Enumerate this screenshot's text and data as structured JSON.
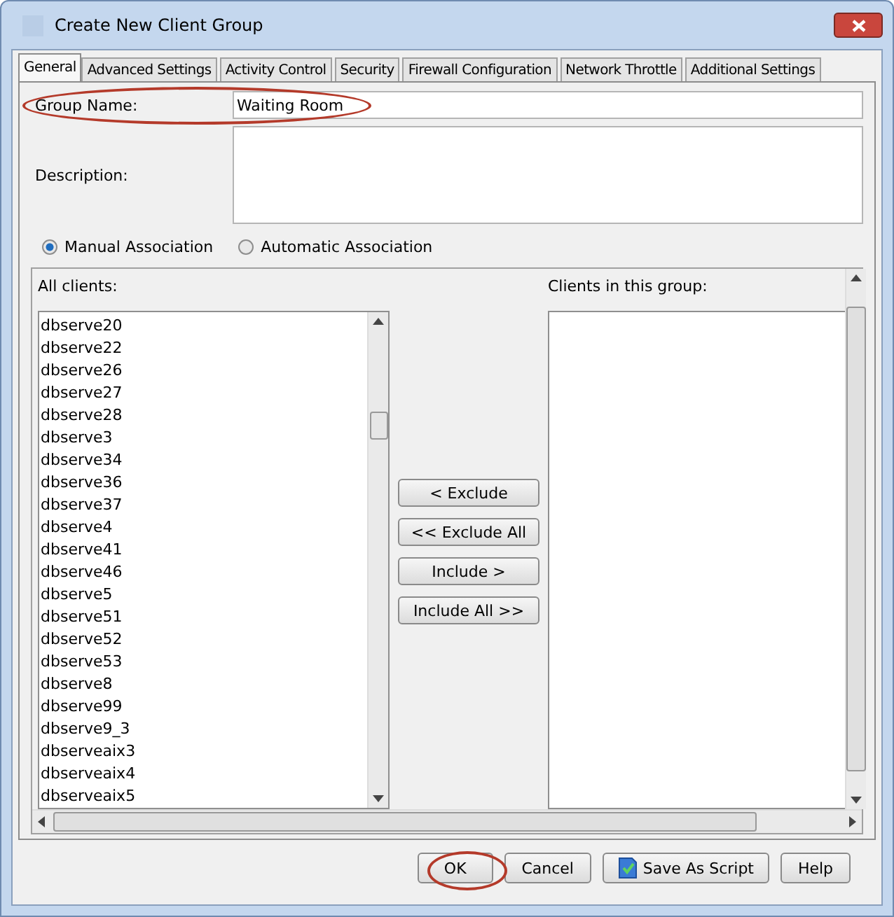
{
  "window": {
    "title": "Create New Client Group"
  },
  "tabs": [
    {
      "label": "General",
      "selected": true
    },
    {
      "label": "Advanced Settings",
      "selected": false
    },
    {
      "label": "Activity Control",
      "selected": false
    },
    {
      "label": "Security",
      "selected": false
    },
    {
      "label": "Firewall Configuration",
      "selected": false
    },
    {
      "label": "Network Throttle",
      "selected": false
    },
    {
      "label": "Additional Settings",
      "selected": false
    }
  ],
  "group_name": {
    "label": "Group Name:",
    "value": "Waiting Room"
  },
  "description": {
    "label": "Description:"
  },
  "association": [
    {
      "label": "Manual Association",
      "selected": true
    },
    {
      "label": "Automatic Association",
      "selected": false
    }
  ],
  "all_clients": {
    "label": "All clients:",
    "items": [
      "dbserve20",
      "dbserve22",
      "dbserve26",
      "dbserve27",
      "dbserve28",
      "dbserve3",
      "dbserve34",
      "dbserve36",
      "dbserve37",
      "dbserve4",
      "dbserve41",
      "dbserve46",
      "dbserve5",
      "dbserve51",
      "dbserve52",
      "dbserve53",
      "dbserve8",
      "dbserve99",
      "dbserve9_3",
      "dbserveaix3",
      "dbserveaix4",
      "dbserveaix5"
    ]
  },
  "move_buttons": [
    "< Exclude",
    "<< Exclude All",
    "Include >",
    "Include All >>"
  ],
  "group_clients": {
    "label": "Clients in this group:"
  },
  "buttons": [
    {
      "label": "OK",
      "kind": "text"
    },
    {
      "label": "Cancel",
      "kind": "text"
    },
    {
      "label": "Save As Script",
      "kind": "script"
    },
    {
      "label": "Help",
      "kind": "text"
    }
  ]
}
